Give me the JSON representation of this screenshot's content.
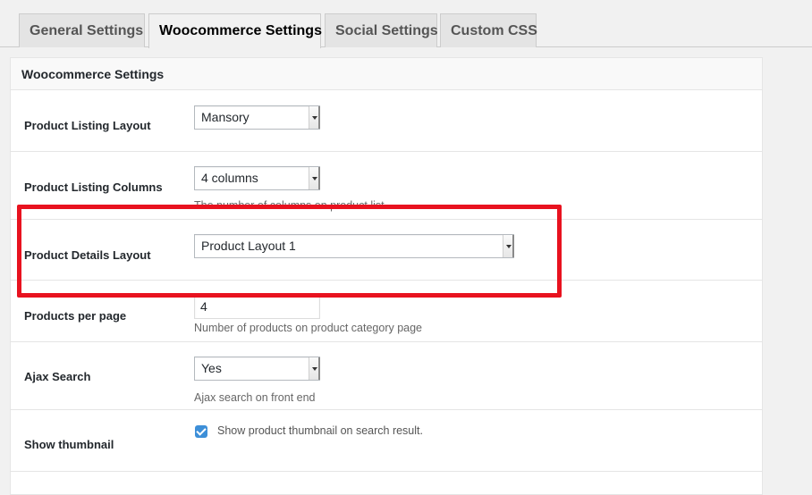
{
  "tabs": [
    {
      "label": "General Settings",
      "active": false
    },
    {
      "label": "Woocommerce Settings",
      "active": true
    },
    {
      "label": "Social Settings",
      "active": false
    },
    {
      "label": "Custom CSS",
      "active": false
    }
  ],
  "panel": {
    "title": "Woocommerce Settings"
  },
  "rows": [
    {
      "label": "Product Listing Layout",
      "control": "select",
      "value": "Mansory"
    },
    {
      "label": "Product Listing Columns",
      "control": "select",
      "value": "4 columns",
      "description": "The number of columns on product list"
    },
    {
      "label": "Product Details Layout",
      "control": "select",
      "value": "Product Layout 1"
    },
    {
      "label": "Products per page",
      "control": "text",
      "value": "4",
      "description": "Number of products on product category page"
    },
    {
      "label": "Ajax Search",
      "control": "select",
      "value": "Yes",
      "description": "Ajax search on front end"
    },
    {
      "label": "Show thumbnail",
      "control": "checkbox",
      "checked": true,
      "checkbox_label": "Show product thumbnail on search result."
    }
  ],
  "colors": {
    "highlight": "#e8121f",
    "checkbox": "#3d8fd8"
  },
  "icons": {
    "select_arrow": "chevron-down-icon",
    "checkbox": "checkmark-icon"
  }
}
